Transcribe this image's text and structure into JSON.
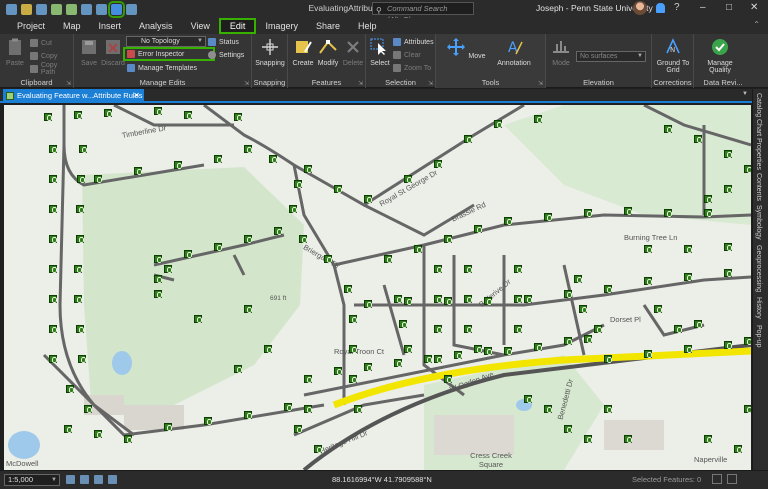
{
  "window": {
    "title": "EvaluatingAttributeRules",
    "command_search_placeholder": "Command Search (Alt+Q)",
    "user": "Joseph - Penn State University",
    "help": "?",
    "controls": [
      "–",
      "□",
      "✕"
    ]
  },
  "ribbon_tabs": [
    "Project",
    "Map",
    "Insert",
    "Analysis",
    "View",
    "Edit",
    "Imagery",
    "Share",
    "Help"
  ],
  "active_tab": "Edit",
  "ribbon": {
    "clipboard": {
      "label": "Clipboard",
      "paste": "Paste",
      "cut": "Cut",
      "copy": "Copy",
      "copy_path": "Copy Path"
    },
    "manage_edits": {
      "label": "Manage Edits",
      "save": "Save",
      "discard": "Discard",
      "topology_value": "No Topology",
      "error_inspector": "Error Inspector",
      "manage_templates": "Manage Templates",
      "status": "Status",
      "settings": "Settings"
    },
    "snapping": {
      "label": "Snapping",
      "button": "Snapping"
    },
    "features": {
      "label": "Features",
      "create": "Create",
      "modify": "Modify",
      "delete": "Delete"
    },
    "selection": {
      "label": "Selection",
      "select": "Select",
      "attributes": "Attributes",
      "clear": "Clear",
      "zoom_to": "Zoom To"
    },
    "tools": {
      "label": "Tools",
      "move": "Move",
      "annotation": "Annotation"
    },
    "elevation": {
      "label": "Elevation",
      "mode": "Mode",
      "surface_placeholder": "No surfaces"
    },
    "corrections": {
      "label": "Corrections",
      "ground_to_grid": "Ground To Grid"
    },
    "data_reviewer": {
      "label": "Data Revi...",
      "manage_quality": "Manage Quality"
    }
  },
  "document_tab": {
    "title": "Evaluating Feature w...Attribute Rules",
    "close": "✕"
  },
  "dock_items": [
    "Catalog",
    "Chart Properties",
    "Contents",
    "Symbology",
    "Geoprocessing",
    "History",
    "Pop-up"
  ],
  "map": {
    "labels": [
      "Timberline Dr",
      "Royal St George Dr",
      "Briergate Dr",
      "Burning Tree Ln",
      "Brassie Rd",
      "Bellerive Dr",
      "Dorset Pl",
      "Royal Troon Ct",
      "W Ogden Ave",
      "Heritage Hill Dr",
      "Benedetti Dr",
      "Cress Creek Square",
      "McDowell",
      "Naperville",
      "691 ft"
    ]
  },
  "status_bar": {
    "scale": "1:5,000",
    "coordinates": "88.1616994°W 41.7909588°N",
    "selected_features": "Selected Features: 0"
  }
}
